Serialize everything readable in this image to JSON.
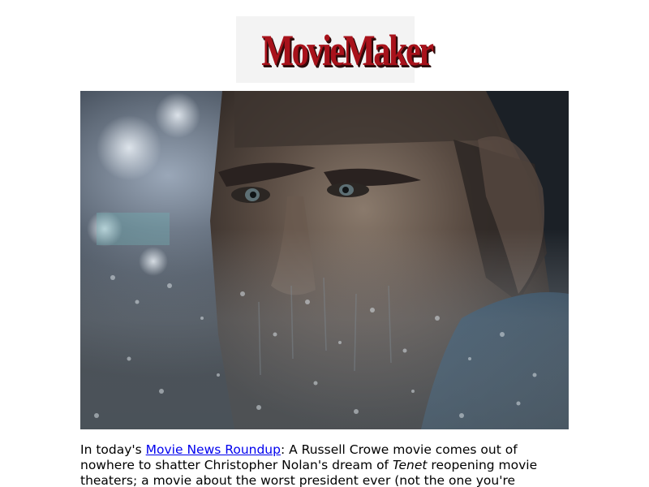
{
  "logo": {
    "text": "MovieMaker"
  },
  "hero_image": {
    "alt": "Russell Crowe behind rain-covered car window"
  },
  "article": {
    "intro": "In today's ",
    "link_label": "Movie News Roundup",
    "after_link": ": A Russell Crowe movie comes out of nowhere to shatter Christopher Nolan's dream of ",
    "italic_title": "Tenet",
    "tail": " reopening movie theaters; a movie about the worst president ever (not the one you're"
  },
  "colors": {
    "logo_red": "#a8121b",
    "link_blue": "#0000ee"
  }
}
